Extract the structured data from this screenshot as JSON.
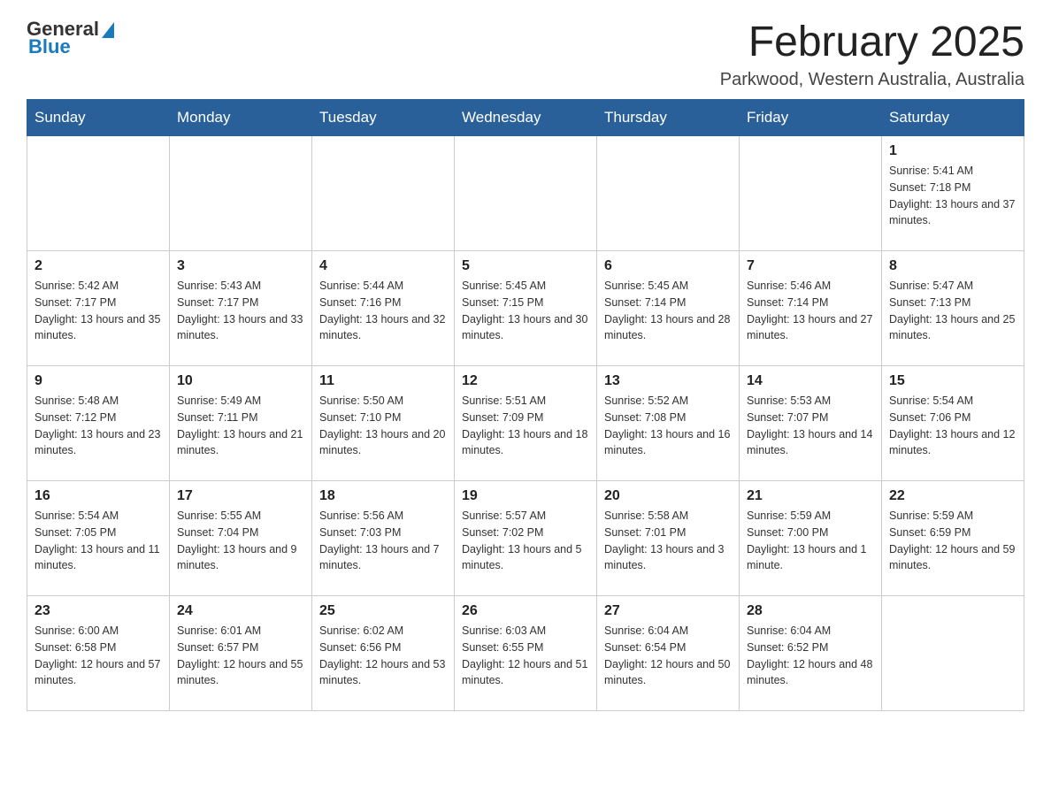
{
  "header": {
    "logo_general": "General",
    "logo_blue": "Blue",
    "title": "February 2025",
    "location": "Parkwood, Western Australia, Australia"
  },
  "days_of_week": [
    "Sunday",
    "Monday",
    "Tuesday",
    "Wednesday",
    "Thursday",
    "Friday",
    "Saturday"
  ],
  "weeks": [
    [
      {
        "day": "",
        "info": ""
      },
      {
        "day": "",
        "info": ""
      },
      {
        "day": "",
        "info": ""
      },
      {
        "day": "",
        "info": ""
      },
      {
        "day": "",
        "info": ""
      },
      {
        "day": "",
        "info": ""
      },
      {
        "day": "1",
        "info": "Sunrise: 5:41 AM\nSunset: 7:18 PM\nDaylight: 13 hours and 37 minutes."
      }
    ],
    [
      {
        "day": "2",
        "info": "Sunrise: 5:42 AM\nSunset: 7:17 PM\nDaylight: 13 hours and 35 minutes."
      },
      {
        "day": "3",
        "info": "Sunrise: 5:43 AM\nSunset: 7:17 PM\nDaylight: 13 hours and 33 minutes."
      },
      {
        "day": "4",
        "info": "Sunrise: 5:44 AM\nSunset: 7:16 PM\nDaylight: 13 hours and 32 minutes."
      },
      {
        "day": "5",
        "info": "Sunrise: 5:45 AM\nSunset: 7:15 PM\nDaylight: 13 hours and 30 minutes."
      },
      {
        "day": "6",
        "info": "Sunrise: 5:45 AM\nSunset: 7:14 PM\nDaylight: 13 hours and 28 minutes."
      },
      {
        "day": "7",
        "info": "Sunrise: 5:46 AM\nSunset: 7:14 PM\nDaylight: 13 hours and 27 minutes."
      },
      {
        "day": "8",
        "info": "Sunrise: 5:47 AM\nSunset: 7:13 PM\nDaylight: 13 hours and 25 minutes."
      }
    ],
    [
      {
        "day": "9",
        "info": "Sunrise: 5:48 AM\nSunset: 7:12 PM\nDaylight: 13 hours and 23 minutes."
      },
      {
        "day": "10",
        "info": "Sunrise: 5:49 AM\nSunset: 7:11 PM\nDaylight: 13 hours and 21 minutes."
      },
      {
        "day": "11",
        "info": "Sunrise: 5:50 AM\nSunset: 7:10 PM\nDaylight: 13 hours and 20 minutes."
      },
      {
        "day": "12",
        "info": "Sunrise: 5:51 AM\nSunset: 7:09 PM\nDaylight: 13 hours and 18 minutes."
      },
      {
        "day": "13",
        "info": "Sunrise: 5:52 AM\nSunset: 7:08 PM\nDaylight: 13 hours and 16 minutes."
      },
      {
        "day": "14",
        "info": "Sunrise: 5:53 AM\nSunset: 7:07 PM\nDaylight: 13 hours and 14 minutes."
      },
      {
        "day": "15",
        "info": "Sunrise: 5:54 AM\nSunset: 7:06 PM\nDaylight: 13 hours and 12 minutes."
      }
    ],
    [
      {
        "day": "16",
        "info": "Sunrise: 5:54 AM\nSunset: 7:05 PM\nDaylight: 13 hours and 11 minutes."
      },
      {
        "day": "17",
        "info": "Sunrise: 5:55 AM\nSunset: 7:04 PM\nDaylight: 13 hours and 9 minutes."
      },
      {
        "day": "18",
        "info": "Sunrise: 5:56 AM\nSunset: 7:03 PM\nDaylight: 13 hours and 7 minutes."
      },
      {
        "day": "19",
        "info": "Sunrise: 5:57 AM\nSunset: 7:02 PM\nDaylight: 13 hours and 5 minutes."
      },
      {
        "day": "20",
        "info": "Sunrise: 5:58 AM\nSunset: 7:01 PM\nDaylight: 13 hours and 3 minutes."
      },
      {
        "day": "21",
        "info": "Sunrise: 5:59 AM\nSunset: 7:00 PM\nDaylight: 13 hours and 1 minute."
      },
      {
        "day": "22",
        "info": "Sunrise: 5:59 AM\nSunset: 6:59 PM\nDaylight: 12 hours and 59 minutes."
      }
    ],
    [
      {
        "day": "23",
        "info": "Sunrise: 6:00 AM\nSunset: 6:58 PM\nDaylight: 12 hours and 57 minutes."
      },
      {
        "day": "24",
        "info": "Sunrise: 6:01 AM\nSunset: 6:57 PM\nDaylight: 12 hours and 55 minutes."
      },
      {
        "day": "25",
        "info": "Sunrise: 6:02 AM\nSunset: 6:56 PM\nDaylight: 12 hours and 53 minutes."
      },
      {
        "day": "26",
        "info": "Sunrise: 6:03 AM\nSunset: 6:55 PM\nDaylight: 12 hours and 51 minutes."
      },
      {
        "day": "27",
        "info": "Sunrise: 6:04 AM\nSunset: 6:54 PM\nDaylight: 12 hours and 50 minutes."
      },
      {
        "day": "28",
        "info": "Sunrise: 6:04 AM\nSunset: 6:52 PM\nDaylight: 12 hours and 48 minutes."
      },
      {
        "day": "",
        "info": ""
      }
    ]
  ]
}
